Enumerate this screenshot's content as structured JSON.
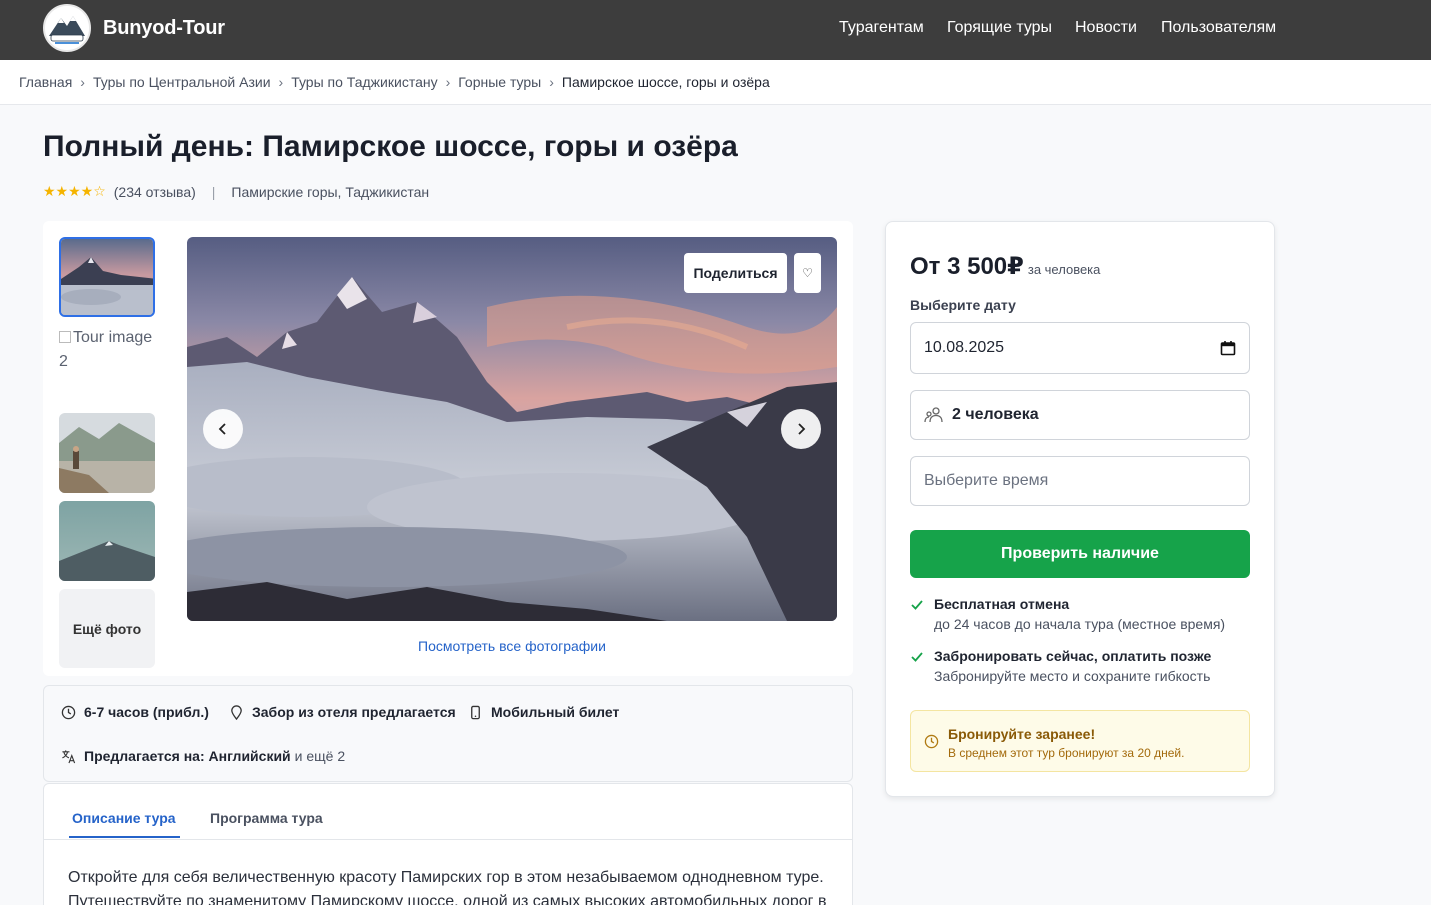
{
  "header": {
    "brand": "Bunyod-Tour",
    "nav": [
      "Турагентам",
      "Горящие туры",
      "Новости",
      "Пользователям"
    ]
  },
  "breadcrumb": [
    "Главная",
    "Туры по Центральной Азии",
    "Туры по Таджикистану",
    "Горные туры",
    "Памирское шоссе, горы и озёра"
  ],
  "tour": {
    "title": "Полный день: Памирское шоссе, горы и озёра",
    "stars": "★★★★☆",
    "reviews": "(234 отзыва)",
    "location": "Памирские горы, Таджикистан"
  },
  "gallery": {
    "broken_image_alt": "Tour image 2",
    "more_photos": "Ещё фото",
    "share": "Поделиться",
    "view_all": "Посмотреть все фотографии"
  },
  "features": {
    "duration": "6-7 часов (прибл.)",
    "pickup": "Забор из отеля предлагается",
    "ticket": "Мобильный билет",
    "language_label": "Предлагается на: Английский",
    "language_more": "и ещё 2"
  },
  "tabs": {
    "description": "Описание тура",
    "program": "Программа тура",
    "text": "Откройте для себя величественную красоту Памирских гор в этом незабываемом однодневном туре. Путешествуйте по знаменитому Памирскому шоссе, одной из самых высоких автомобильных дорог в"
  },
  "booking": {
    "price": "От 3 500₽",
    "per_person": "за человека",
    "date_label": "Выберите дату",
    "date_value": "10.08.2025",
    "people": "2 человека",
    "time_placeholder": "Выберите время",
    "check_button": "Проверить наличие",
    "benefit1_title": "Бесплатная отмена",
    "benefit1_sub": "до 24 часов до начала тура (местное время)",
    "benefit2_title": "Забронировать сейчас, оплатить позже",
    "benefit2_sub": "Забронируйте место и сохраните гибкость",
    "notice_title": "Бронируйте заранее!",
    "notice_sub": "В среднем этот тур бронируют за 20 дней."
  },
  "colors": {
    "header_bg": "#3d3d3d",
    "accent_blue": "#2563c9",
    "cta_green": "#16a34a",
    "star": "#f5b400"
  }
}
